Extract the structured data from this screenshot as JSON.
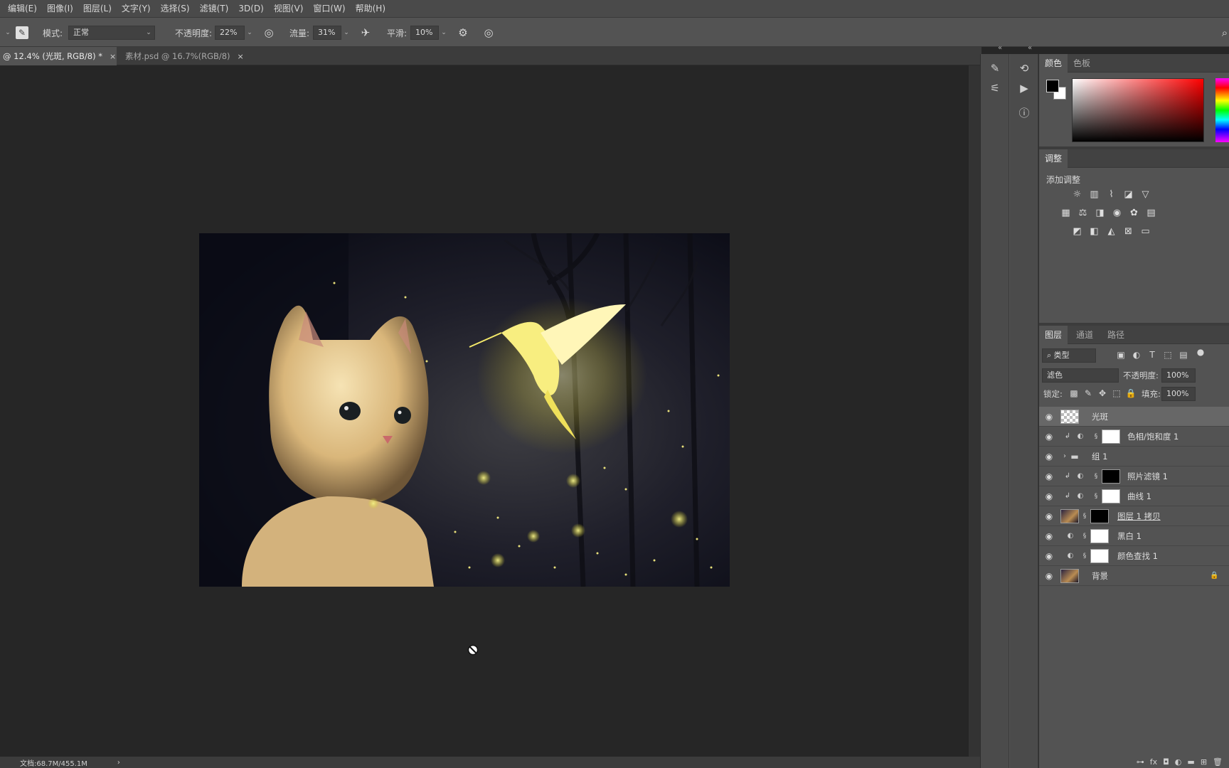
{
  "menu": [
    "编辑(E)",
    "图像(I)",
    "图层(L)",
    "文字(Y)",
    "选择(S)",
    "滤镜(T)",
    "3D(D)",
    "视图(V)",
    "窗口(W)",
    "帮助(H)"
  ],
  "options": {
    "mode_label": "模式:",
    "mode_value": "正常",
    "opacity_label": "不透明度:",
    "opacity_value": "22%",
    "flow_label": "流量:",
    "flow_value": "31%",
    "smoothing_label": "平滑:",
    "smoothing_value": "10%"
  },
  "tabs": [
    {
      "label": "@ 12.4% (光斑, RGB/8) *",
      "close": "×"
    },
    {
      "label": "素材.psd @ 16.7%(RGB/8)",
      "close": "×"
    }
  ],
  "status": {
    "doc": "文档:68.7M/455.1M",
    "arrow": "›"
  },
  "color_panel": {
    "tabs": [
      "颜色",
      "色板"
    ],
    "foreground": "#000000",
    "background": "#ffffff"
  },
  "adjustments": {
    "tab": "调整",
    "title": "添加调整",
    "row1_icons": [
      "brightness-contrast-icon",
      "levels-icon",
      "curves-icon",
      "exposure-icon",
      "vibrance-icon"
    ],
    "row2_icons": [
      "hue-saturation-icon",
      "color-balance-icon",
      "black-white-icon",
      "photo-filter-icon",
      "channel-mixer-icon",
      "color-lookup-icon"
    ],
    "row3_icons": [
      "invert-icon",
      "posterize-icon",
      "threshold-icon",
      "selective-color-icon",
      "gradient-map-icon"
    ]
  },
  "layers_panel": {
    "tabs": [
      "图层",
      "通道",
      "路径"
    ],
    "filter_kind": "类型",
    "blend_mode": "滤色",
    "opacity_label": "不透明度:",
    "opacity_value": "100%",
    "lock_label": "锁定:",
    "fill_label": "填充:",
    "fill_value": "100%",
    "layers": [
      {
        "name": "光斑",
        "selected": true
      },
      {
        "name": "色相/饱和度 1",
        "selected": false
      },
      {
        "name": "组 1",
        "selected": false
      },
      {
        "name": "照片滤镜 1",
        "selected": false
      },
      {
        "name": "曲线 1",
        "selected": false
      },
      {
        "name": "图层 1 拷贝",
        "selected": false
      },
      {
        "name": "黑白 1",
        "selected": false
      },
      {
        "name": "颜色查找 1",
        "selected": false
      },
      {
        "name": "背景",
        "selected": false
      }
    ]
  }
}
